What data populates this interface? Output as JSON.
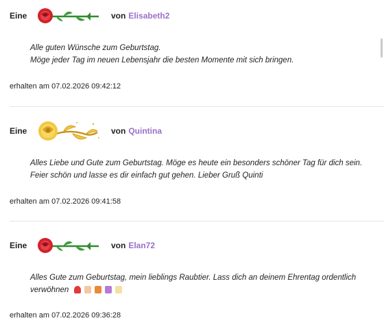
{
  "feed": {
    "gifts": [
      {
        "eine_label": "Eine",
        "gift_icon": "red-rose-icon",
        "von_label": "von",
        "sender": "Elisabeth2",
        "message_lines": [
          "Alle guten Wünsche zum Geburtstag.",
          " Möge jeder Tag im neuen Lebensjahr die besten Momente mit sich bringen."
        ],
        "received": "erhalten am 07.02.2026 09:42:12"
      },
      {
        "eine_label": "Eine",
        "gift_icon": "golden-rose-icon",
        "von_label": "von",
        "sender": "Quintina",
        "message_lines": [
          "Alles Liebe und Gute zum Geburtstag. Möge es heute ein besonders schöner Tag für dich sein.",
          "Feier schön und lasse es dir einfach  gut gehen. Lieber Gruß Quinti"
        ],
        "received": "erhalten am 07.02.2026 09:41:58"
      },
      {
        "eine_label": "Eine",
        "gift_icon": "red-rose-icon",
        "von_label": "von",
        "sender": "Elan72",
        "message_lines": [
          "Alles Gute zum Geburtstag, mein lieblings Raubtier. Lass dich an deinem Ehrentag ordentlich",
          "verwöhnen"
        ],
        "emojis": [
          "rose-emoji",
          "cake-emoji",
          "gift-emoji",
          "party-popper-emoji",
          "candle-emoji"
        ],
        "received": "erhalten am 07.02.2026 09:36:28"
      }
    ]
  },
  "colors": {
    "sender": "#9b6fc9",
    "divider": "#e4e4e4",
    "rose_red": "#d4202a",
    "stem_green": "#2f8a2f",
    "gold": "#e7b321"
  }
}
